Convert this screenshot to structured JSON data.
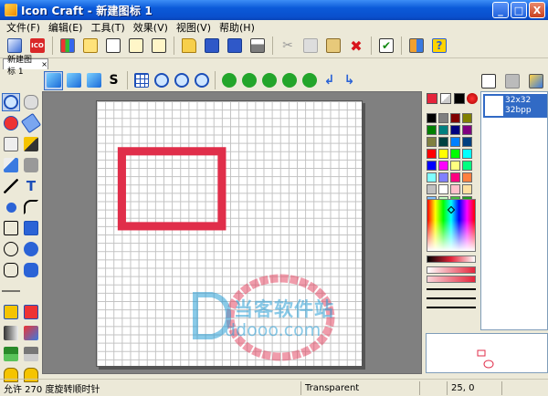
{
  "window": {
    "title": "Icon Craft - 新建图标 1",
    "buttons": [
      "_",
      "□",
      "X"
    ]
  },
  "menu": {
    "items": [
      "文件(F)",
      "编辑(E)",
      "工具(T)",
      "效果(V)",
      "视图(V)",
      "帮助(H)"
    ]
  },
  "toolbar": {
    "ico_label": "ICO",
    "icons": [
      "new-project-icon",
      "ico-file-icon",
      "palette-icon",
      "edit-icon",
      "select-icon",
      "import-icon",
      "export-icon",
      "open-folder-icon",
      "save-icon",
      "save-all-icon",
      "print-icon",
      "cut-icon",
      "copy-icon",
      "paste-icon",
      "delete-icon",
      "check-icon",
      "grid-settings-icon",
      "help-icon"
    ]
  },
  "tab": {
    "label": "新建图标 1",
    "close": "×"
  },
  "toolbar2": {
    "icons": [
      "cube-1-icon",
      "cube-2-icon",
      "cube-3-icon",
      "dollar-icon",
      "grid-icon",
      "zoom-in-icon",
      "zoom-out-icon",
      "zoom-auto-icon",
      "move-icon",
      "move-h-icon",
      "move-v-icon",
      "center-icon",
      "undo-icon",
      "redo-icon"
    ]
  },
  "tools": [
    "circle-select-icon",
    "lasso-icon",
    "fill-icon",
    "eraser-icon",
    "eyedropper-icon",
    "brush-icon",
    "pencil-icon",
    "spray-icon",
    "line-icon",
    "text-icon",
    "ellipse-icon",
    "curve-icon",
    "rect-icon",
    "filled-rect-icon",
    "ellipse-outline-icon",
    "filled-ellipse-icon",
    "rounded-rect-icon",
    "filled-rounded-rect-icon",
    "line-width-1-icon",
    "line-width-2-icon",
    "dot-small-icon",
    "dot-large-icon",
    "gradient-1-icon",
    "gradient-2-icon",
    "layer-icon",
    "layer-2-icon",
    "lock-a-icon",
    "lock-b-icon"
  ],
  "colors": {
    "primary": "#e5243b",
    "swatches": [
      "#000000",
      "#808080",
      "#800000",
      "#808000",
      "#008000",
      "#008080",
      "#000080",
      "#800080",
      "#808040",
      "#004040",
      "#0080ff",
      "#004080",
      "#ff0000",
      "#ffff00",
      "#00ff00",
      "#00ffff",
      "#0000ff",
      "#ff00ff",
      "#ffff80",
      "#00ff80",
      "#80ffff",
      "#8080ff",
      "#ff0080",
      "#ff8040",
      "#c0c0c0",
      "#ffffff",
      "#ffc0cb",
      "#ffe0a0",
      "#80c0ff",
      "#c0ffc0",
      "#40c040",
      "#20a020"
    ]
  },
  "icon_list": {
    "size": "32x32",
    "depth": "32bpp"
  },
  "status": {
    "left": "允许 270 度旋转顺时针",
    "transparency": "Transparent",
    "coords": "25, 0"
  },
  "watermark": {
    "brand": "当客软件站",
    "url": "ddooo.com"
  }
}
